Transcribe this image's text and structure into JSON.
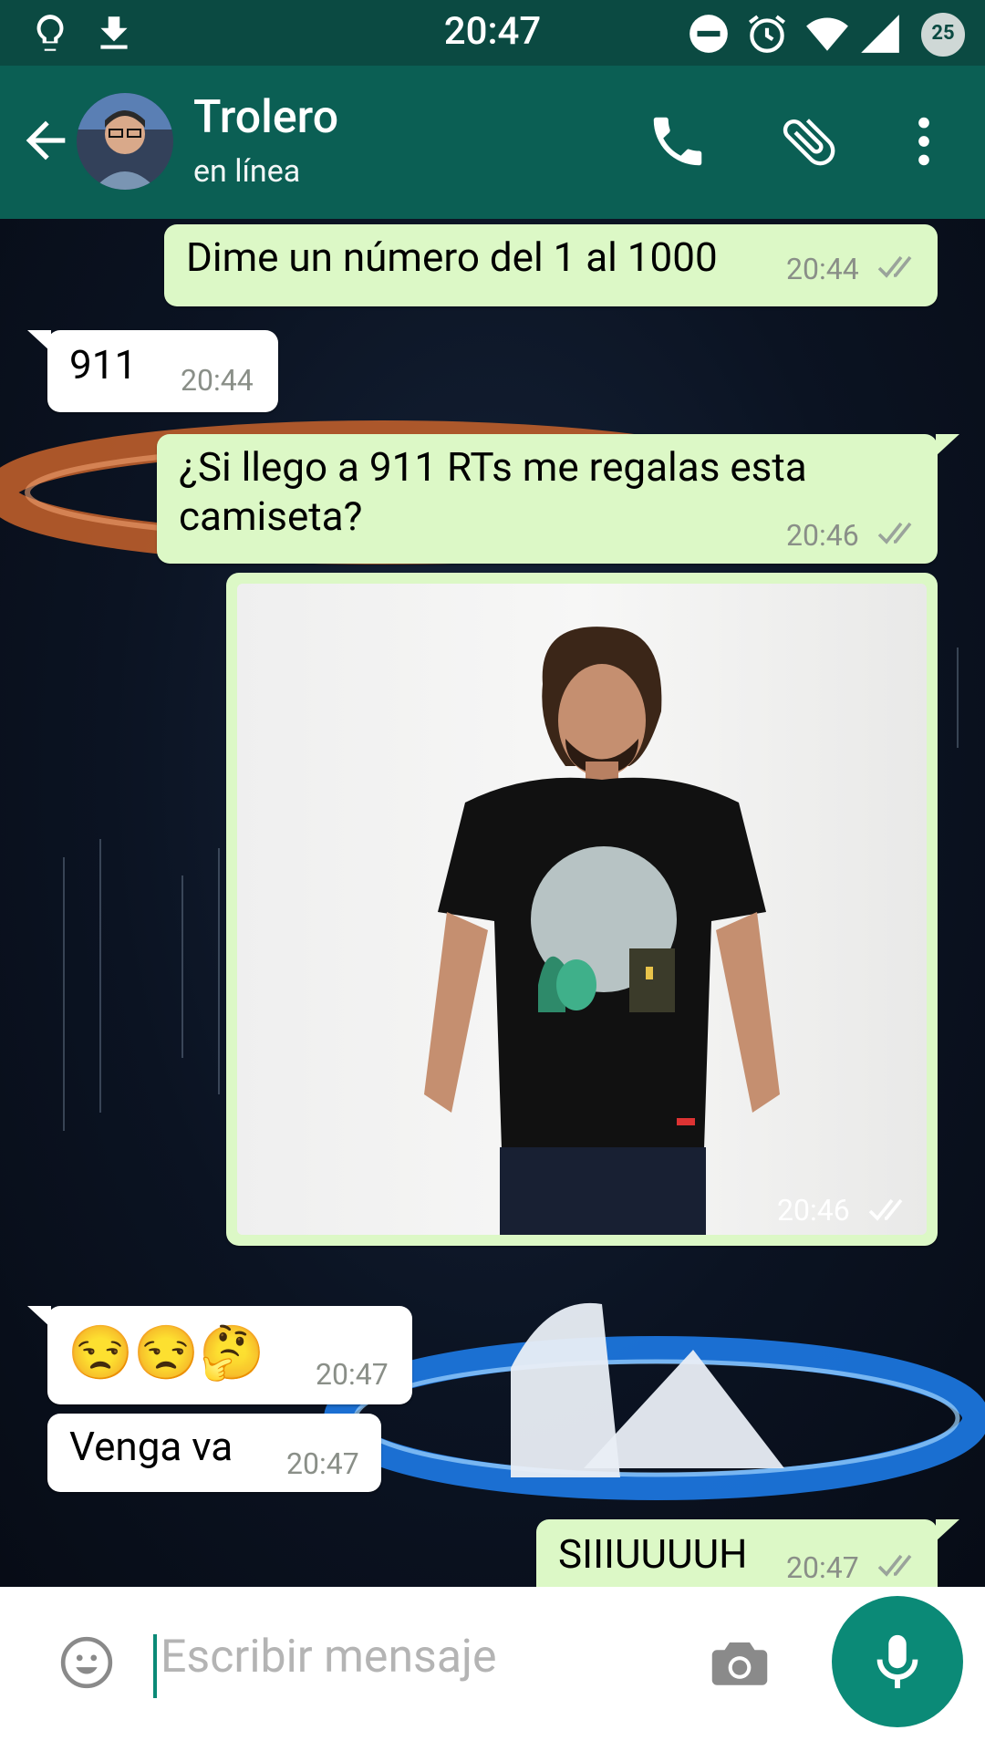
{
  "status_bar": {
    "time": "20:47",
    "battery": "25"
  },
  "header": {
    "contact_name": "Trolero",
    "status": "en línea"
  },
  "messages": [
    {
      "text": "Dime un número del 1 al 1000",
      "time": "20:44",
      "dir": "out"
    },
    {
      "text": "911",
      "time": "20:44",
      "dir": "in"
    },
    {
      "line1": "¿Si llego a 911 RTs me regalas esta",
      "line2": "camiseta?",
      "time": "20:46",
      "dir": "out"
    },
    {
      "time": "20:46",
      "dir": "out",
      "type": "image"
    },
    {
      "emojis": [
        "😒",
        "😒",
        "🤔"
      ],
      "time": "20:47",
      "dir": "in"
    },
    {
      "text": "Venga va",
      "time": "20:47",
      "dir": "in"
    },
    {
      "text": "SIIIUUUUH",
      "time": "20:47",
      "dir": "out"
    }
  ],
  "composer": {
    "placeholder": "Escribir mensaje"
  },
  "colors": {
    "header": "#0b5f54",
    "statusbar": "#0b4a42",
    "outgoing": "#dcf8c6",
    "incoming": "#ffffff",
    "accent": "#0b8a77"
  }
}
